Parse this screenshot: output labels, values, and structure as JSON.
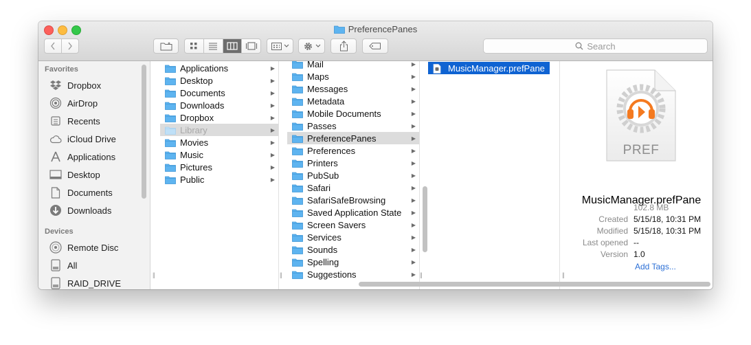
{
  "window": {
    "title": "PreferencePanes"
  },
  "toolbar": {
    "search_placeholder": "Search"
  },
  "sidebar": {
    "favorites_header": "Favorites",
    "favorites": [
      {
        "label": "Dropbox",
        "icon": "dropbox-icon"
      },
      {
        "label": "AirDrop",
        "icon": "airdrop-icon"
      },
      {
        "label": "Recents",
        "icon": "recents-icon"
      },
      {
        "label": "iCloud Drive",
        "icon": "cloud-icon"
      },
      {
        "label": "Applications",
        "icon": "applications-icon"
      },
      {
        "label": "Desktop",
        "icon": "desktop-icon"
      },
      {
        "label": "Documents",
        "icon": "documents-icon"
      },
      {
        "label": "Downloads",
        "icon": "downloads-icon"
      }
    ],
    "devices_header": "Devices",
    "devices": [
      {
        "label": "Remote Disc",
        "icon": "disc-icon"
      },
      {
        "label": "All",
        "icon": "drive-icon"
      },
      {
        "label": "RAID_DRIVE",
        "icon": "drive-icon"
      }
    ]
  },
  "columns": [
    {
      "items": [
        {
          "label": "Applications"
        },
        {
          "label": "Desktop"
        },
        {
          "label": "Documents"
        },
        {
          "label": "Downloads"
        },
        {
          "label": "Dropbox"
        },
        {
          "label": "Library"
        },
        {
          "label": "Movies"
        },
        {
          "label": "Music"
        },
        {
          "label": "Pictures"
        },
        {
          "label": "Public"
        }
      ]
    },
    {
      "items": [
        {
          "label": "Mail"
        },
        {
          "label": "Maps"
        },
        {
          "label": "Messages"
        },
        {
          "label": "Metadata"
        },
        {
          "label": "Mobile Documents"
        },
        {
          "label": "Passes"
        },
        {
          "label": "PreferencePanes"
        },
        {
          "label": "Preferences"
        },
        {
          "label": "Printers"
        },
        {
          "label": "PubSub"
        },
        {
          "label": "Safari"
        },
        {
          "label": "SafariSafeBrowsing"
        },
        {
          "label": "Saved Application State"
        },
        {
          "label": "Screen Savers"
        },
        {
          "label": "Services"
        },
        {
          "label": "Sounds"
        },
        {
          "label": "Spelling"
        },
        {
          "label": "Suggestions"
        }
      ]
    },
    {
      "items": [
        {
          "label": "MusicManager.prefPane"
        }
      ]
    }
  ],
  "preview": {
    "icon_label": "PREF",
    "name": "MusicManager.prefPane",
    "size": "102.8 MB",
    "created_label": "Created",
    "created": "5/15/18, 10:31 PM",
    "modified_label": "Modified",
    "modified": "5/15/18, 10:31 PM",
    "opened_label": "Last opened",
    "opened": "--",
    "version_label": "Version",
    "version": "1.0",
    "add_tags": "Add Tags..."
  },
  "colors": {
    "selection": "#0f63d2",
    "folder": "#5eb4f0",
    "music_accent": "#f47a20"
  }
}
